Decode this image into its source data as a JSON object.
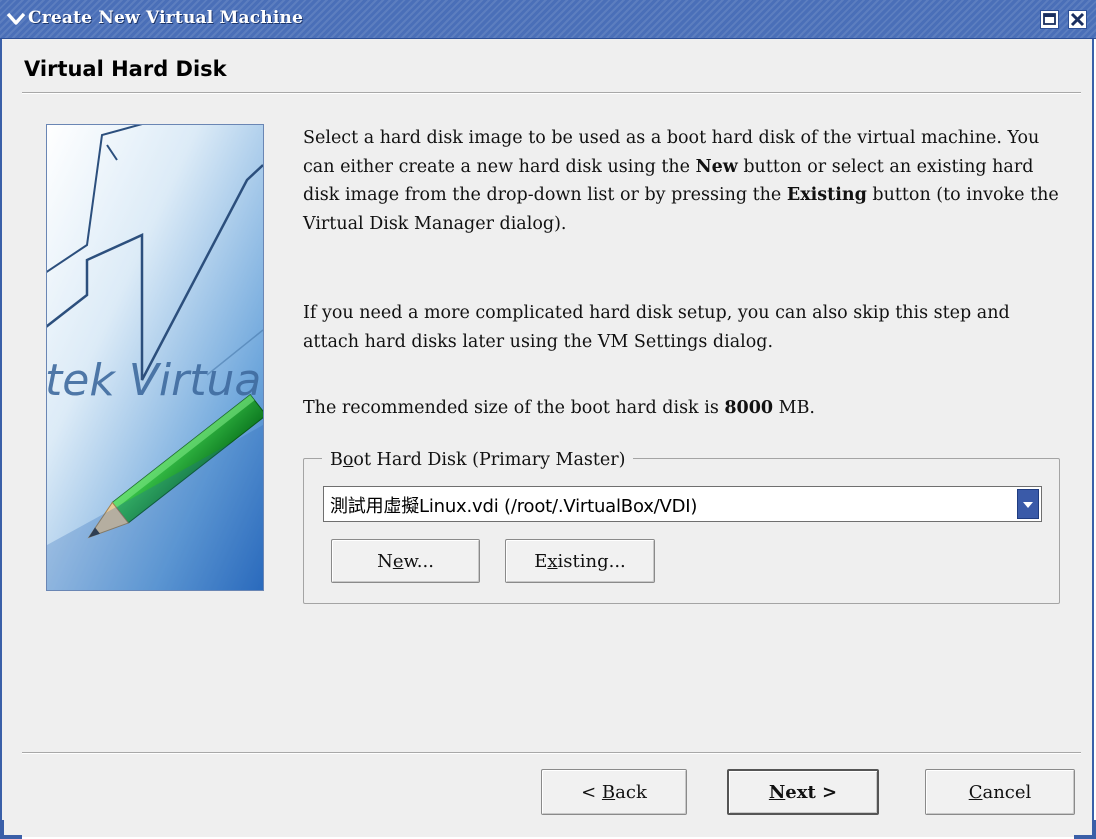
{
  "window": {
    "title": "Create New Virtual Machine"
  },
  "page": {
    "title": "Virtual Hard Disk"
  },
  "art": {
    "text": "tek Virtua"
  },
  "description": {
    "p1_a": "Select a hard disk image to be used as a boot hard disk of the virtual machine. You can either create a new hard disk using the ",
    "p1_new": "New",
    "p1_b": " button or select an existing hard disk image from the drop-down list or by pressing the ",
    "p1_existing": "Existing",
    "p1_c": " button (to invoke the Virtual Disk Manager dialog).",
    "p2": "If you need a more complicated hard disk setup, you can also skip this step and attach hard disks later using the VM Settings dialog.",
    "p3_a": "The recommended size of the boot hard disk is ",
    "p3_size": "8000",
    "p3_b": " MB."
  },
  "boot_disk": {
    "legend_pre": "B",
    "legend_key": "o",
    "legend_post": "ot Hard Disk (Primary Master)",
    "selected": "測試用虛擬Linux.vdi (/root/.VirtualBox/VDI)",
    "new_pre": "N",
    "new_key": "e",
    "new_post": "w...",
    "existing_pre": "E",
    "existing_key": "x",
    "existing_post": "isting..."
  },
  "footer": {
    "back_prefix": "< ",
    "back_key": "B",
    "back_rest": "ack",
    "next_key": "N",
    "next_rest": "ext >",
    "cancel_key": "C",
    "cancel_rest": "ancel"
  },
  "colors": {
    "titlebar": "#4a6fb8",
    "accent": "#3a5aa8"
  }
}
